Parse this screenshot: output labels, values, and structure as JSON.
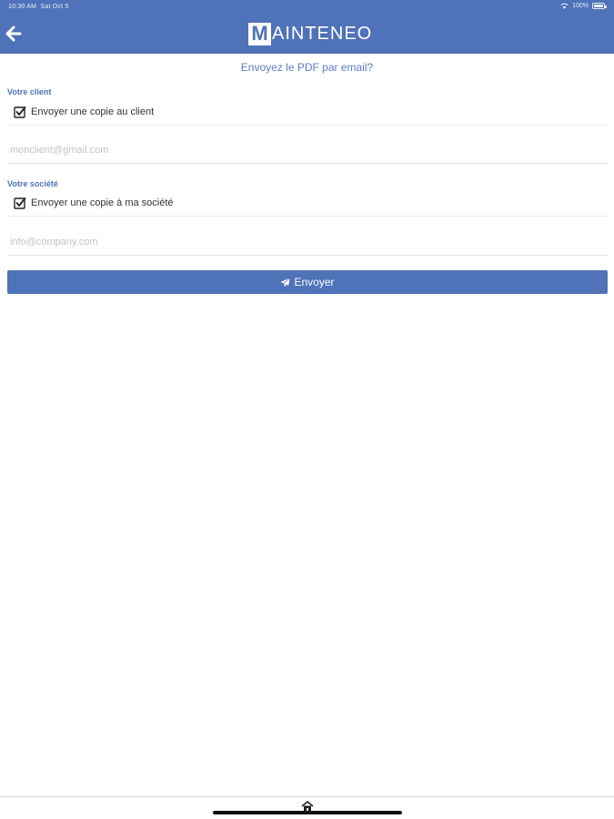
{
  "status_bar": {
    "time": "10:30 AM",
    "date": "Sat Oct 5",
    "battery": "100%",
    "icons": [
      "wifi-icon",
      "battery-icon"
    ]
  },
  "header": {
    "logo_initial": "M",
    "logo_text": "AINTENEO",
    "back_icon": "arrow-left-icon",
    "color": "#4f72b8"
  },
  "prompt": "Envoyez le PDF par email?",
  "client": {
    "section_label": "Votre client",
    "checkbox_label": "Envoyer une copie au client",
    "checked": true,
    "email_placeholder": "monclient@gmail.com",
    "email_value": ""
  },
  "company": {
    "section_label": "Votre société",
    "checkbox_label": "Envoyer une copie à ma société",
    "checked": true,
    "email_placeholder": "info@company.com",
    "email_value": ""
  },
  "send_button": {
    "label": "Envoyer",
    "icon": "paper-plane-icon"
  },
  "bottom_bar": {
    "icon": "home-icon"
  }
}
